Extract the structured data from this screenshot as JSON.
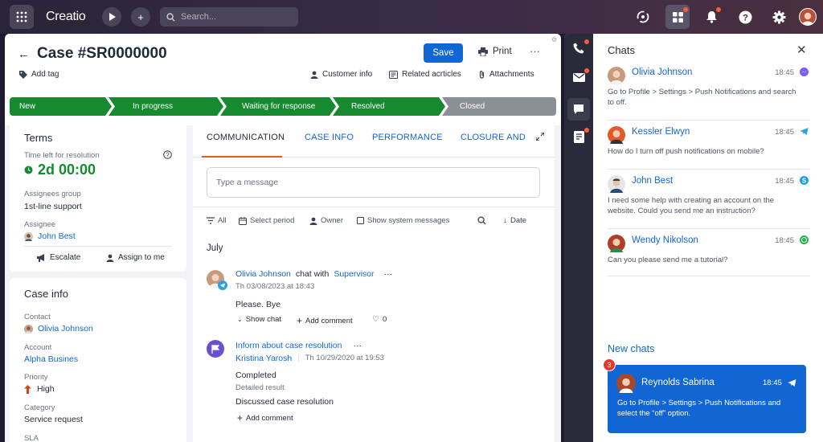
{
  "app": {
    "logo": "Creatio",
    "search_placeholder": "Search..."
  },
  "case": {
    "title": "Case #SR0000000",
    "save_label": "Save",
    "print_label": "Print",
    "add_tag_label": "Add tag",
    "header_links": [
      "Customer info",
      "Related acrticles",
      "Attachments"
    ]
  },
  "stages": [
    "New",
    "In progress",
    "Waiting for response",
    "Resolved",
    "Closed"
  ],
  "terms": {
    "title": "Terms",
    "time_left_label": "Time left for resolution",
    "time_left_value": "2d 00:00",
    "assignees_group_label": "Assignees group",
    "assignees_group_value": "1st-line support",
    "assignee_label": "Assignee",
    "assignee_value": "John Best",
    "escalate_label": "Escalate",
    "assign_to_me_label": "Assign to me"
  },
  "case_info": {
    "title": "Case info",
    "contact_label": "Contact",
    "contact_value": "Olivia Johnson",
    "account_label": "Account",
    "account_value": "Alpha Busines",
    "priority_label": "Priority",
    "priority_value": "High",
    "category_label": "Category",
    "category_value": "Service request",
    "sla_label": "SLA"
  },
  "tabs": [
    "COMMUNICATION",
    "CASE INFO",
    "PERFORMANCE",
    "CLOSURE AND"
  ],
  "message_placeholder": "Type a message",
  "filters": {
    "all": "All",
    "period": "Select period",
    "owner": "Owner",
    "system": "Show system messages",
    "sort": "Date"
  },
  "feed": {
    "month": "July",
    "entry1": {
      "name": "Olivia Johnson",
      "action": "chat with",
      "target": "Supervisor",
      "date": "Th 03/08/2023 at 18:43",
      "text": "Please. Bye",
      "show_chat": "Show chat",
      "add_comment": "Add comment",
      "likes": "0"
    },
    "entry2": {
      "title": "Inform about case resolution",
      "person": "Kristina Yarosh",
      "date": "Th 10/29/2020 at 19:53",
      "status": "Completed",
      "result_label": "Detailed result",
      "result_text": "Discussed case resolution",
      "add_comment": "Add comment"
    }
  },
  "chats": {
    "title": "Chats",
    "items": [
      {
        "name": "Olivia Johnson",
        "time": "18:45",
        "text": "Go to Profile > Settings > Push Notifications and search to off.",
        "app": "messenger-icon"
      },
      {
        "name": "Kessler Elwyn",
        "time": "18:45",
        "text": "How do I turn off push notifications on mobile?",
        "app": "telegram-icon"
      },
      {
        "name": "John Best",
        "time": "18:45",
        "text": "I need some help with creating an account on the website. Could you send me an instruction?",
        "app": "skype-icon"
      },
      {
        "name": "Wendy Nikolson",
        "time": "18:45",
        "text": "Can you please send me a tutorial?",
        "app": "whatsapp-icon"
      }
    ],
    "new_chats_title": "New chats",
    "new_chat": {
      "badge": "3",
      "name": "Reynolds Sabrina",
      "time": "18:45",
      "text": "Go to Profile > Settings > Push Notifications and select the “off” option."
    }
  },
  "colors": {
    "accent": "#1266d4",
    "stage_active": "#168a2f",
    "stage_inactive": "#8b8f96",
    "tab_underline": "#e55a1f"
  }
}
